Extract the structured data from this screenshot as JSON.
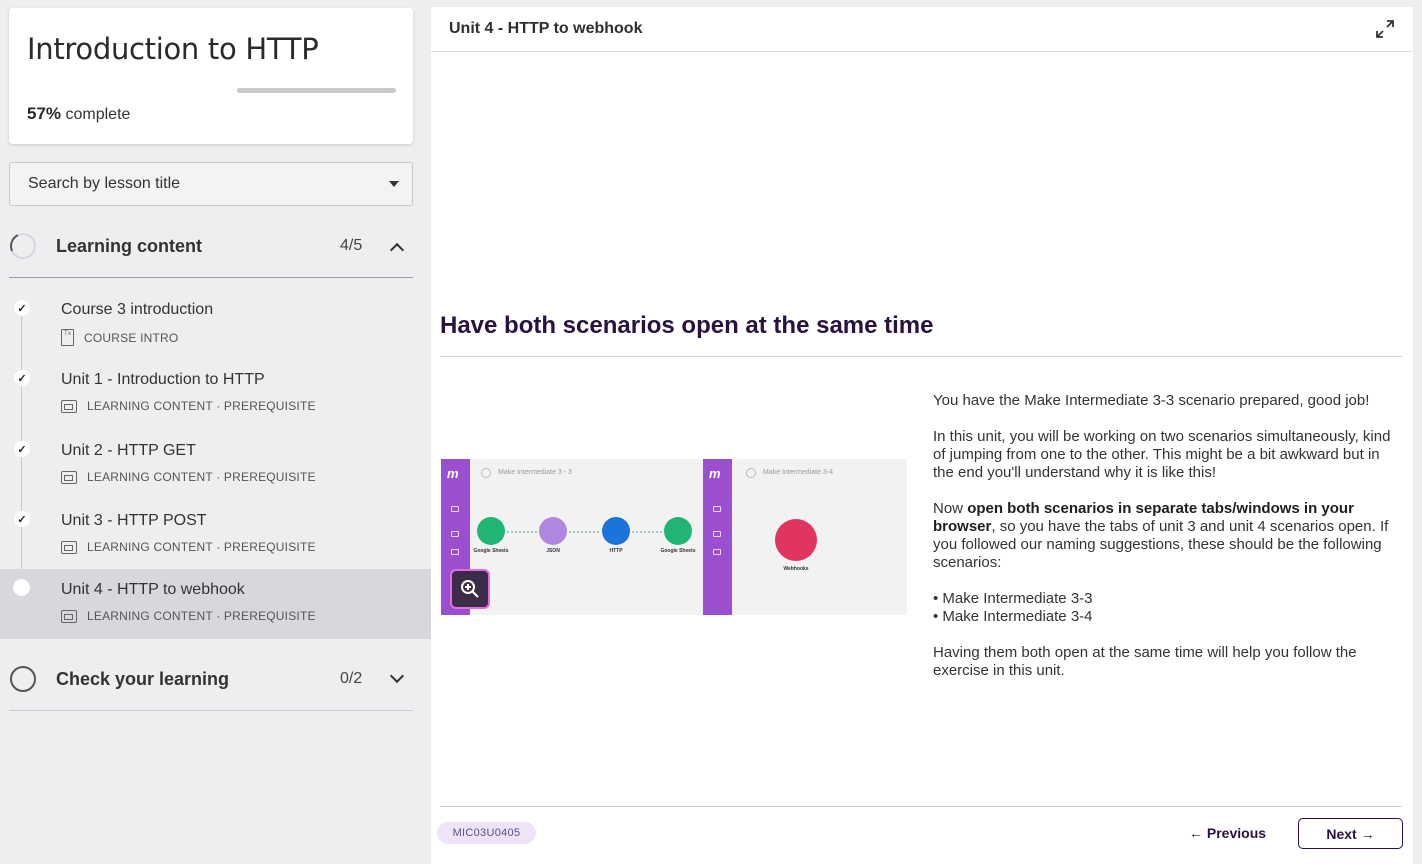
{
  "course": {
    "title": "Introduction to HTTP",
    "progress_percent_label": "57%",
    "progress_suffix": "complete",
    "progress_value": 0.57
  },
  "search": {
    "placeholder": "Search by lesson title"
  },
  "sections": [
    {
      "label": "Learning content",
      "count": "4/5",
      "expanded": true,
      "lessons": [
        {
          "title": "Course 3 introduction",
          "meta": "COURSE INTRO",
          "completed": true,
          "active": false
        },
        {
          "title": "Unit 1 - Introduction to HTTP",
          "meta": "LEARNING CONTENT · PREREQUISITE",
          "completed": true,
          "active": false
        },
        {
          "title": "Unit 2 - HTTP GET",
          "meta": "LEARNING CONTENT · PREREQUISITE",
          "completed": true,
          "active": false
        },
        {
          "title": "Unit 3 - HTTP POST",
          "meta": "LEARNING CONTENT · PREREQUISITE",
          "completed": true,
          "active": false
        },
        {
          "title": "Unit 4 - HTTP to webhook",
          "meta": "LEARNING CONTENT · PREREQUISITE",
          "completed": false,
          "active": true
        }
      ]
    },
    {
      "label": "Check your learning",
      "count": "0/2",
      "expanded": false
    }
  ],
  "main": {
    "header_title": "Unit 4 - HTTP to webhook",
    "heading": "Have both scenarios open at the same time",
    "illustration": {
      "scenario_a": "Make Intermediate 3 - 3",
      "scenario_b": "Make Intermediate 3-4",
      "modules": [
        "Google Sheets",
        "JSON",
        "HTTP",
        "Google Sheets",
        "Webhooks"
      ]
    },
    "paragraph1": "You have the Make Intermediate 3-3 scenario prepared, good job!",
    "paragraph2": "In this unit, you will be working on two scenarios simultaneously, kind of jumping from one to the other. This might be a bit awkward but in the end you'll understand why it is like this!",
    "paragraph3_pre": "Now ",
    "paragraph3_bold": "open both scenarios in separate tabs/windows in your browser",
    "paragraph3_post": ", so you have the tabs of unit 3 and unit 4 scenarios open. If you followed our naming suggestions, these should be the following scenarios:",
    "bullets": [
      "Make Intermediate 3-3",
      "Make Intermediate 3-4"
    ],
    "paragraph4": "Having them both open at the same time will help you follow the exercise in this unit.",
    "code": "MIC03U0405",
    "prev_label": "Previous",
    "next_label": "Next"
  },
  "colors": {
    "accent": "#2a1140",
    "brand_purple": "#9a4fd0",
    "badge_bg": "#efe4f7"
  }
}
